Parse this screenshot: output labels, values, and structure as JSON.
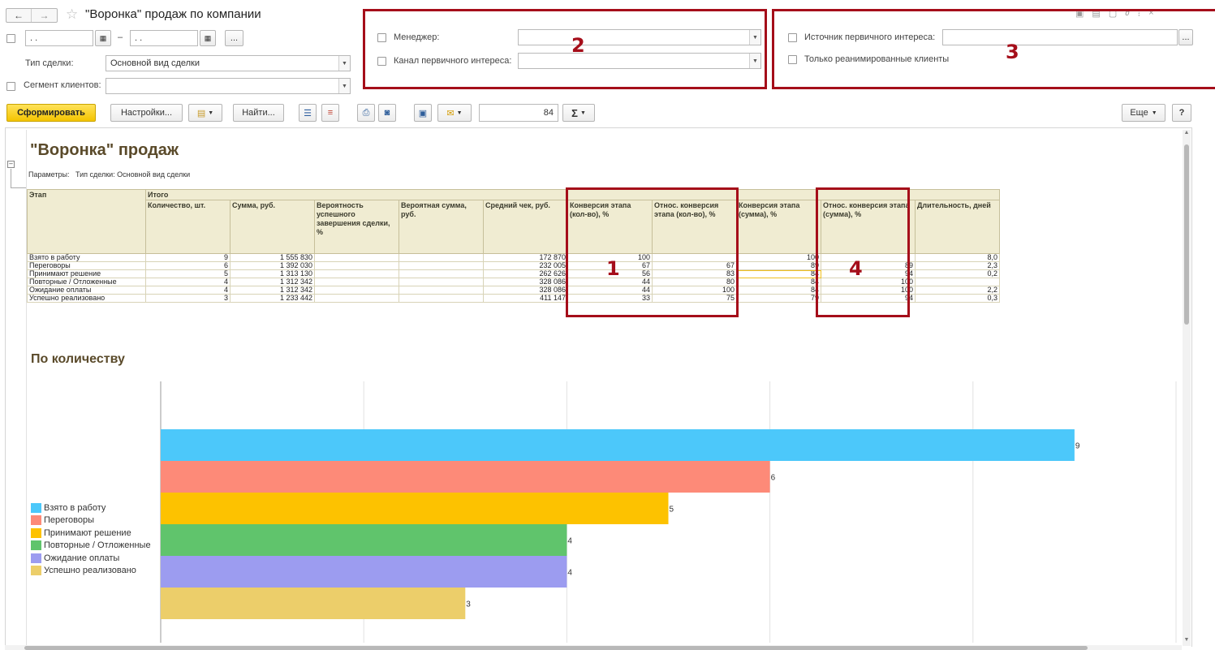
{
  "window": {
    "title": "\"Воронка\" продаж по компании"
  },
  "filters": {
    "date_from": "  .  .",
    "date_to": "  .  .",
    "date_dash": "–",
    "more": "...",
    "deal_type_label": "Тип сделки:",
    "deal_type_value": "Основной вид сделки",
    "segment_label": "Сегмент клиентов:",
    "manager_label": "Менеджер:",
    "channel_label": "Канал первичного интереса:",
    "source_label": "Источник первичного интереса:",
    "reanimated_label": "Только реанимированные клиенты"
  },
  "toolbar": {
    "generate": "Сформировать",
    "settings": "Настройки...",
    "find": "Найти...",
    "scale": "84",
    "sigma": "Σ",
    "more": "Еще",
    "help": "?"
  },
  "annotations": [
    "1",
    "2",
    "3",
    "4"
  ],
  "report": {
    "title": "\"Воронка\" продаж",
    "params_label": "Параметры:",
    "params_value": "Тип сделки: Основной вид сделки",
    "header": {
      "stage": "Этап",
      "total": "Итого",
      "columns": [
        "Количество, шт.",
        "Сумма, руб.",
        "Вероятность успешного завершения сделки, %",
        "Вероятная сумма, руб.",
        "Средний чек, руб.",
        "Конверсия этапа (кол-во), %",
        "Относ. конверсия этапа (кол-во), %",
        "Конверсия этапа (сумма), %",
        "Относ. конверсия этапа (сумма), %",
        "Длительность, дней"
      ]
    },
    "rows": [
      [
        "Взято в работу",
        "9",
        "1 555 830",
        "",
        "",
        "172 870",
        "100",
        "",
        "100",
        "",
        "8,0"
      ],
      [
        "Переговоры",
        "6",
        "1 392 030",
        "",
        "",
        "232 005",
        "67",
        "67",
        "89",
        "89",
        "2,3"
      ],
      [
        "Принимают решение",
        "5",
        "1 313 130",
        "",
        "",
        "262 626",
        "56",
        "83",
        "84",
        "94",
        "0,2"
      ],
      [
        "Повторные / Отложенные",
        "4",
        "1 312 342",
        "",
        "",
        "328 086",
        "44",
        "80",
        "84",
        "100",
        ""
      ],
      [
        "Ожидание оплаты",
        "4",
        "1 312 342",
        "",
        "",
        "328 086",
        "44",
        "100",
        "84",
        "100",
        "2,2"
      ],
      [
        "Успешно реализовано",
        "3",
        "1 233 442",
        "",
        "",
        "411 147",
        "33",
        "75",
        "79",
        "94",
        "0,3"
      ]
    ]
  },
  "chart_data": {
    "type": "bar",
    "title": "По количеству",
    "orientation": "horizontal",
    "categories": [
      "Взято в работу",
      "Переговоры",
      "Принимают решение",
      "Повторные / Отложенные",
      "Ожидание оплаты",
      "Успешно реализовано"
    ],
    "values": [
      9,
      6,
      5,
      4,
      4,
      3
    ],
    "colors": [
      "#4cc8fa",
      "#fd8a78",
      "#fdc200",
      "#60c46c",
      "#9c9cf0",
      "#ecce6a"
    ],
    "xlim": [
      0,
      10
    ],
    "legend": "left",
    "grid": true
  }
}
